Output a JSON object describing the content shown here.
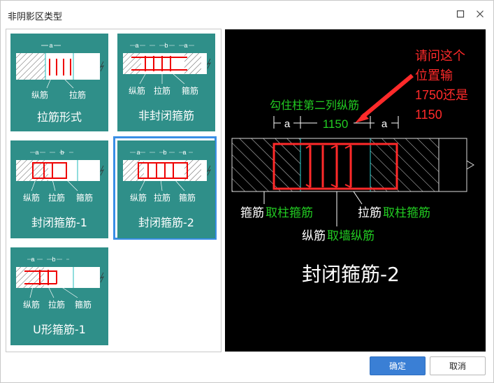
{
  "window": {
    "title": "非阴影区类型",
    "maximize_icon": "square-icon",
    "close_icon": "close-icon"
  },
  "tiles": [
    {
      "label": "拉筋形式",
      "dim_a": "a",
      "legend": [
        "纵筋",
        "拉筋"
      ]
    },
    {
      "label": "非封闭箍筋",
      "dim_a": "a",
      "dim_b": "b",
      "legend": [
        "纵筋",
        "拉筋",
        "箍筋"
      ]
    },
    {
      "label": "封闭箍筋-1",
      "dim_a": "a",
      "dim_b": "b",
      "legend": [
        "纵筋",
        "拉筋",
        "箍筋"
      ]
    },
    {
      "label": "封闭箍筋-2",
      "dim_a": "a",
      "dim_b": "b",
      "legend": [
        "纵筋",
        "拉筋",
        "箍筋"
      ]
    },
    {
      "label": "U形箍筋-1",
      "dim_a": "a",
      "dim_b": "b",
      "legend": [
        "纵筋",
        "拉筋",
        "箍筋"
      ]
    }
  ],
  "selected_index": 3,
  "preview": {
    "heading_green": "勾住柱第二列纵筋",
    "dim_a_left": "a",
    "dim_mid": "1150",
    "dim_a_right": "a",
    "question_lines": [
      "请问这个",
      "位置输",
      "1750还是",
      "1150"
    ],
    "left_label_white": "箍筋",
    "left_label_green": "取柱箍筋",
    "right_label_white": "拉筋",
    "right_label_green": "取柱箍筋",
    "bottom_label_white": "纵筋",
    "bottom_label_green": "取墙纵筋",
    "title": "封闭箍筋-2",
    "colors": {
      "green": "#22cc22",
      "red": "#ff2a2a",
      "cyan": "#2fd3d3"
    }
  },
  "buttons": {
    "ok": "确定",
    "cancel": "取消"
  }
}
